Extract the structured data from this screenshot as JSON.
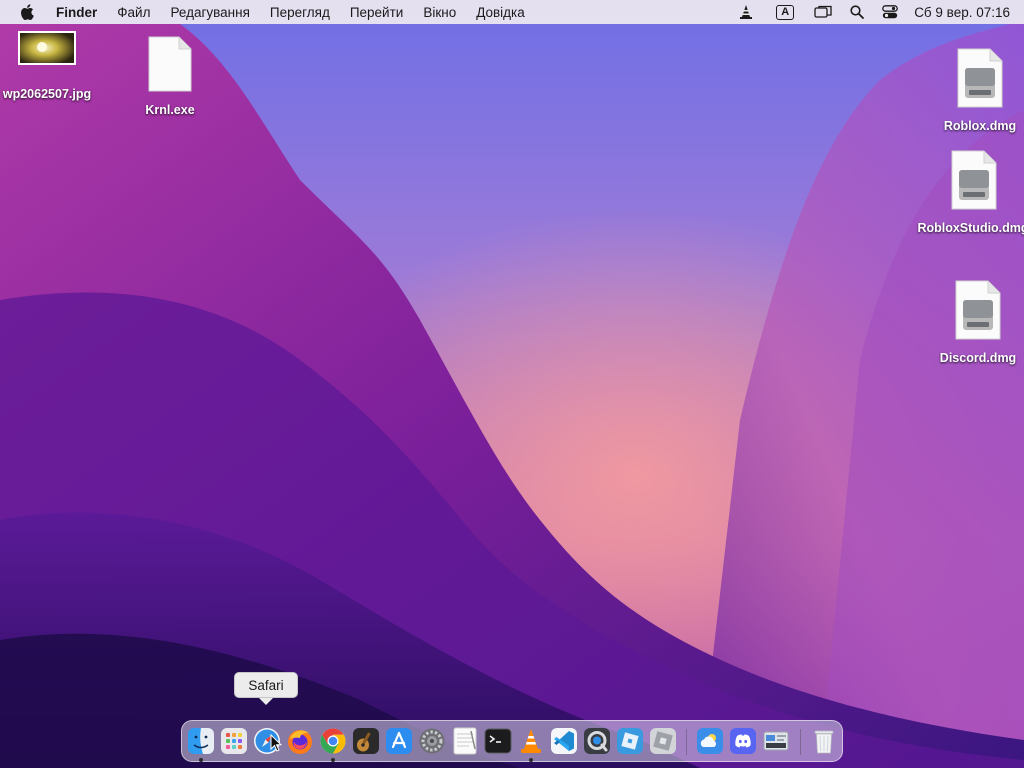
{
  "menubar": {
    "apple_icon": "apple-logo-icon",
    "app_name": "Finder",
    "menus": [
      "Файл",
      "Редагування",
      "Перегляд",
      "Перейти",
      "Вікно",
      "Довідка"
    ],
    "input_source_label": "A",
    "status_icons": [
      "vlc-cone-icon",
      "keyboard-input-icon",
      "screen-mirroring-icon",
      "search-icon",
      "control-center-icon"
    ],
    "clock": "Сб 9 вер.  07:16"
  },
  "desktop": {
    "files": [
      {
        "name": "wp2062507.jpg",
        "icon": "image-thumbnail-icon"
      },
      {
        "name": "Krnl.exe",
        "icon": "blank-document-icon"
      },
      {
        "name": "Roblox.dmg",
        "icon": "disk-image-icon"
      },
      {
        "name": "RobloxStudio.dmg",
        "icon": "disk-image-icon"
      },
      {
        "name": "Discord.dmg",
        "icon": "disk-image-icon"
      }
    ]
  },
  "tooltip": {
    "text": "Safari"
  },
  "dock": {
    "items": [
      {
        "name": "Finder",
        "icon": "finder-icon",
        "running": true
      },
      {
        "name": "Launchpad",
        "icon": "launchpad-icon",
        "running": false
      },
      {
        "name": "Safari",
        "icon": "safari-compass-icon",
        "running": false
      },
      {
        "name": "Firefox",
        "icon": "firefox-icon",
        "running": false
      },
      {
        "name": "Chrome",
        "icon": "chrome-icon",
        "running": true
      },
      {
        "name": "Instruments",
        "icon": "guitar-icon",
        "running": false
      },
      {
        "name": "App Store",
        "icon": "app-store-icon",
        "running": false
      },
      {
        "name": "System Preferences",
        "icon": "gear-icon",
        "running": false
      },
      {
        "name": "TextEdit",
        "icon": "text-document-icon",
        "running": false
      },
      {
        "name": "Terminal",
        "icon": "terminal-icon",
        "running": false
      },
      {
        "name": "VLC",
        "icon": "vlc-cone-icon",
        "running": true
      },
      {
        "name": "Visual Studio Code",
        "icon": "vscode-icon",
        "running": false
      },
      {
        "name": "QuickTime Player",
        "icon": "quicktime-icon",
        "running": false
      },
      {
        "name": "Roblox",
        "icon": "roblox-icon",
        "running": false
      },
      {
        "name": "Roblox Studio",
        "icon": "roblox-studio-icon",
        "running": false
      },
      {
        "name": "Weather",
        "icon": "weather-icon",
        "running": false
      },
      {
        "name": "Discord",
        "icon": "discord-icon",
        "running": false
      },
      {
        "name": "Downloads",
        "icon": "downloads-stack-icon",
        "running": false
      },
      {
        "name": "Trash",
        "icon": "trash-icon",
        "running": false
      }
    ]
  },
  "colors": {
    "wallpaper_top": "#7a6ee0",
    "wallpaper_mid": "#8a2fb0",
    "wallpaper_glow": "#e08a9a",
    "wallpaper_dark": "#2a0f5a"
  }
}
